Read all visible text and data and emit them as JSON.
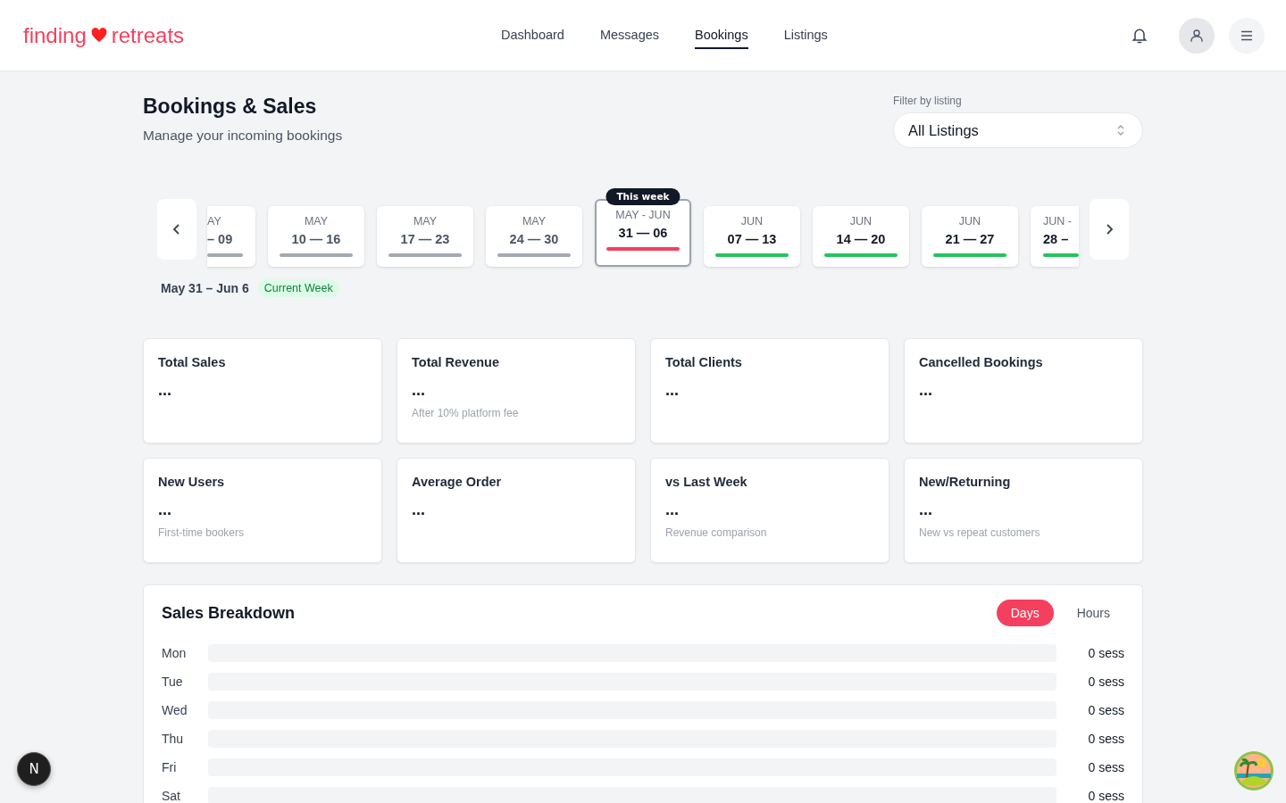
{
  "brand": {
    "left": "finding",
    "right": "retreats"
  },
  "nav": [
    {
      "label": "Dashboard",
      "selected": false
    },
    {
      "label": "Messages",
      "selected": false
    },
    {
      "label": "Bookings",
      "selected": true
    },
    {
      "label": "Listings",
      "selected": false
    }
  ],
  "page": {
    "title": "Bookings & Sales",
    "subtitle": "Manage your incoming bookings"
  },
  "filter": {
    "label": "Filter by listing",
    "value": "All Listings"
  },
  "weeks": [
    {
      "kind": "clipstart",
      "month": "AY",
      "days": "– 09",
      "color": "#a3a8b3",
      "selected": false
    },
    {
      "kind": "full",
      "month": "MAY",
      "days": "10 — 16",
      "color": "#a3a8b3",
      "selected": false
    },
    {
      "kind": "full",
      "month": "MAY",
      "days": "17 — 23",
      "color": "#a3a8b3",
      "selected": false
    },
    {
      "kind": "full",
      "month": "MAY",
      "days": "24 — 30",
      "color": "#a3a8b3",
      "selected": false
    },
    {
      "kind": "full",
      "month": "MAY - JUN",
      "days": "31 — 06",
      "color": "#f43f5e",
      "selected": true,
      "badge": "This week"
    },
    {
      "kind": "full",
      "month": "JUN",
      "days": "07 — 13",
      "color": "#22c55e",
      "selected": false
    },
    {
      "kind": "full",
      "month": "JUN",
      "days": "14 — 20",
      "color": "#22c55e",
      "selected": false
    },
    {
      "kind": "full",
      "month": "JUN",
      "days": "21 — 27",
      "color": "#22c55e",
      "selected": false
    },
    {
      "kind": "clipend",
      "month": "JUN -",
      "days": "28 –",
      "color": "#22c55e",
      "selected": false
    }
  ],
  "range": {
    "label": "May 31 – Jun 6",
    "tag": "Current Week"
  },
  "stats": [
    {
      "title": "Total Sales",
      "value": "..."
    },
    {
      "title": "Total Revenue",
      "value": "...",
      "note": "After 10% platform fee"
    },
    {
      "title": "Total Clients",
      "value": "..."
    },
    {
      "title": "Cancelled Bookings",
      "value": "..."
    },
    {
      "title": "New Users",
      "value": "...",
      "note": "First-time bookers"
    },
    {
      "title": "Average Order",
      "value": "..."
    },
    {
      "title": "vs Last Week",
      "value": "...",
      "note": "Revenue comparison"
    },
    {
      "title": "New/Returning",
      "value": "...",
      "note": "New vs repeat customers"
    }
  ],
  "breakdown": {
    "title": "Sales Breakdown",
    "tabs": [
      {
        "label": "Days",
        "selected": true
      },
      {
        "label": "Hours",
        "selected": false
      }
    ],
    "rows": [
      {
        "label": "Mon",
        "value": "0 sess"
      },
      {
        "label": "Tue",
        "value": "0 sess"
      },
      {
        "label": "Wed",
        "value": "0 sess"
      },
      {
        "label": "Thu",
        "value": "0 sess"
      },
      {
        "label": "Fri",
        "value": "0 sess"
      },
      {
        "label": "Sat",
        "value": "0 sess"
      }
    ]
  },
  "dev_badge": "N"
}
